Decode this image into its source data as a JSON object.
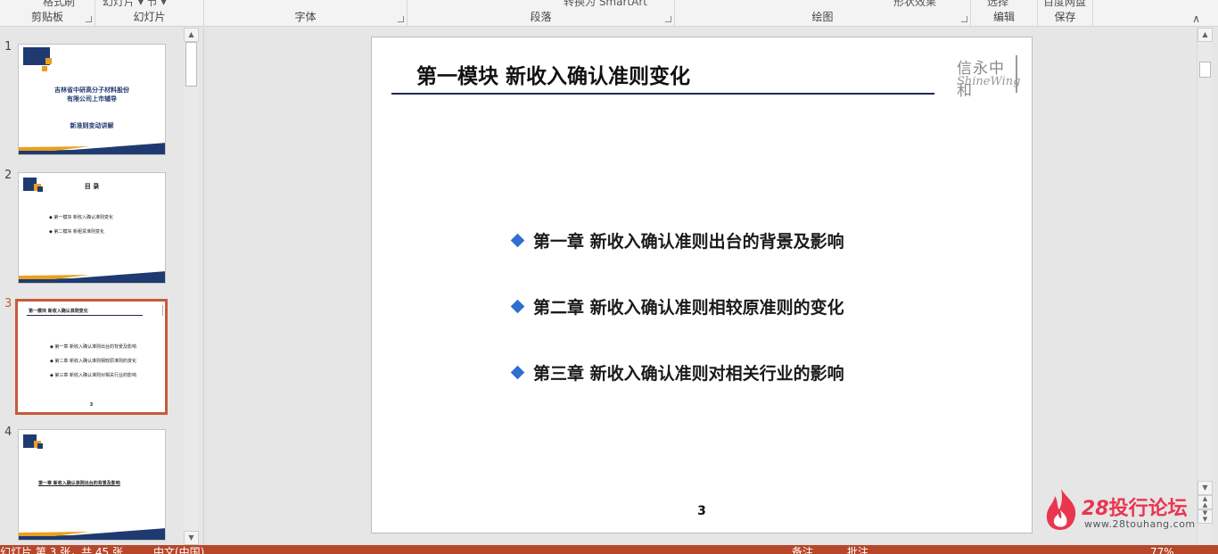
{
  "ribbon": {
    "groups": [
      {
        "label": "剪贴板",
        "top_text": "格式刷"
      },
      {
        "label": "幻灯片",
        "top_text": "幻灯片 ▾   节 ▾"
      },
      {
        "label": "字体",
        "top_text": ""
      },
      {
        "label": "段落",
        "top_text": "转换为 SmartArt"
      },
      {
        "label": "绘图",
        "top_text": "形状效果"
      },
      {
        "label": "编辑",
        "top_text": "选择"
      },
      {
        "label": "保存",
        "top_text": "百度网盘"
      }
    ]
  },
  "thumbnails": [
    {
      "num": "1",
      "lines": [
        "吉林省中研高分子材料股份",
        "有限公司上市辅导",
        "新准则变动讲解"
      ]
    },
    {
      "num": "2",
      "lines": [
        "目    录",
        "◆ 第一模块  新收入确认准则变化",
        "◆ 第二模块  新租赁准则变化"
      ]
    },
    {
      "num": "3",
      "lines": [
        "第一模块    新收入确认准则变化",
        "◆ 第一章   新收入确认准则出台的背景及影响",
        "◆ 第二章   新收入确认准则相较原准则的变化",
        "◆ 第三章   新收入确认准则对相关行业的影响",
        "3"
      ]
    },
    {
      "num": "4",
      "lines": [
        "第一章  新收入确认准则出台的背景及影响"
      ]
    }
  ],
  "slide": {
    "title": "第一模块    新收入确认准则变化",
    "logo_cn": "信永中和",
    "logo_en": "ShineWing",
    "bullets": [
      "第一章    新收入确认准则出台的背景及影响",
      "第二章    新收入确认准则相较原准则的变化",
      "第三章    新收入确认准则对相关行业的影响"
    ],
    "page_number": "3"
  },
  "watermark": {
    "brand_num": "28",
    "brand_text": "投行论坛",
    "url": "www.28touhang.com"
  },
  "status": {
    "slide_info": "幻灯片 第 3 张，共 45 张",
    "language": "中文(中国)",
    "notes": "备注",
    "comments": "批注",
    "zoom": "77%"
  },
  "colors": {
    "accent": "#b7472a",
    "active_thumb_border": "#c75a3c",
    "title_rule": "#1d2a50",
    "bullet_diamond": "#2f6fd0",
    "brand": "#e8364f"
  }
}
